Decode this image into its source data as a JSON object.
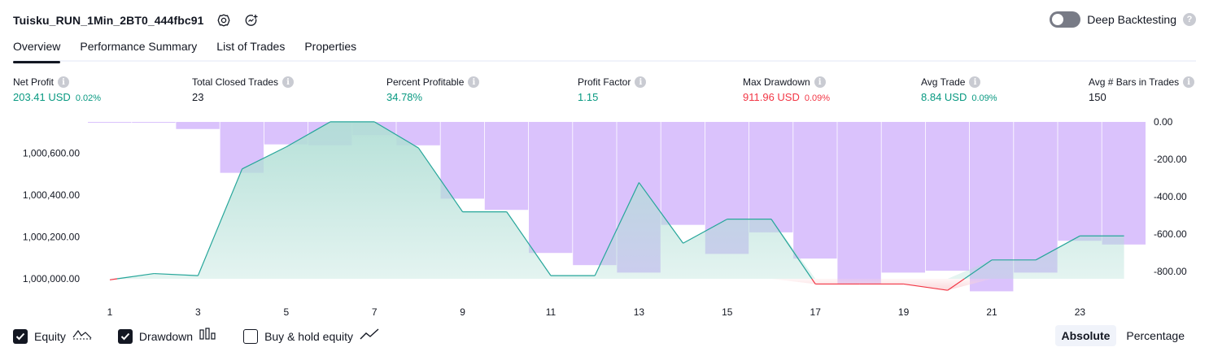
{
  "header": {
    "strategy_name": "Tuisku_RUN_1Min_2BT0_444fbc91",
    "deep_backtesting_label": "Deep Backtesting",
    "deep_backtesting_enabled": false
  },
  "tabs": [
    {
      "label": "Overview",
      "active": true
    },
    {
      "label": "Performance Summary",
      "active": false
    },
    {
      "label": "List of Trades",
      "active": false
    },
    {
      "label": "Properties",
      "active": false
    }
  ],
  "stats": [
    {
      "label": "Net Profit",
      "value": "203.41 USD",
      "pct": "0.02%",
      "tone": "pos"
    },
    {
      "label": "Total Closed Trades",
      "value": "23",
      "pct": "",
      "tone": "neutral"
    },
    {
      "label": "Percent Profitable",
      "value": "34.78%",
      "pct": "",
      "tone": "pos"
    },
    {
      "label": "Profit Factor",
      "value": "1.15",
      "pct": "",
      "tone": "pos"
    },
    {
      "label": "Max Drawdown",
      "value": "911.96 USD",
      "pct": "0.09%",
      "tone": "neg"
    },
    {
      "label": "Avg Trade",
      "value": "8.84 USD",
      "pct": "0.09%",
      "tone": "pos"
    },
    {
      "label": "Avg # Bars in Trades",
      "value": "150",
      "pct": "",
      "tone": "neutral"
    }
  ],
  "chart_data": {
    "type": "line+bar",
    "x_ticks": [
      "1",
      "3",
      "5",
      "7",
      "9",
      "11",
      "13",
      "15",
      "17",
      "19",
      "21",
      "23"
    ],
    "left_axis_ticks": [
      "1,000,600.00",
      "1,000,400.00",
      "1,000,200.00",
      "1,000,000.00"
    ],
    "left_axis_values": [
      1000600,
      1000400,
      1000200,
      1000000
    ],
    "right_axis_ticks": [
      "0.00",
      "-200.00",
      "-400.00",
      "-600.00",
      "-800.00"
    ],
    "right_axis_values": [
      0,
      -200,
      -400,
      -600,
      -800
    ],
    "equity": {
      "x": [
        1,
        2,
        3,
        4,
        5,
        6,
        7,
        8,
        9,
        10,
        11,
        12,
        13,
        14,
        15,
        16,
        17,
        18,
        19,
        20,
        21,
        22,
        23,
        24
      ],
      "values": [
        999995,
        1000025,
        1000015,
        1000525,
        1000630,
        1000750,
        1000750,
        1000625,
        1000320,
        1000320,
        1000015,
        1000015,
        1000460,
        1000170,
        1000285,
        1000285,
        999975,
        999975,
        999975,
        999945,
        1000090,
        1000090,
        1000205,
        1000205
      ]
    },
    "drawdown": {
      "x": [
        1,
        2,
        3,
        4,
        5,
        6,
        7,
        8,
        9,
        10,
        11,
        12,
        13,
        14,
        15,
        16,
        17,
        18,
        19,
        20,
        21,
        22,
        23,
        24
      ],
      "values": [
        -2,
        -2,
        -38,
        -272,
        -120,
        -125,
        -70,
        -125,
        -410,
        -470,
        -700,
        -765,
        -805,
        -550,
        -705,
        -590,
        -730,
        -865,
        -805,
        -795,
        -905,
        -805,
        -635,
        -655
      ]
    },
    "legend": [
      {
        "label": "Equity",
        "checked": true,
        "icon": "equity-line-icon"
      },
      {
        "label": "Drawdown",
        "checked": true,
        "icon": "drawdown-bars-icon"
      },
      {
        "label": "Buy & hold equity",
        "checked": false,
        "icon": "buy-hold-line-icon"
      }
    ],
    "colors": {
      "equity_line": "#26a69a",
      "equity_fill": "#b2dfd6",
      "equity_negative_line": "#f23645",
      "equity_negative_fill": "#fbd5d8",
      "drawdown_bar": "#d1b3fb"
    },
    "grid": false
  },
  "modes": [
    {
      "label": "Absolute",
      "active": true
    },
    {
      "label": "Percentage",
      "active": false
    }
  ]
}
